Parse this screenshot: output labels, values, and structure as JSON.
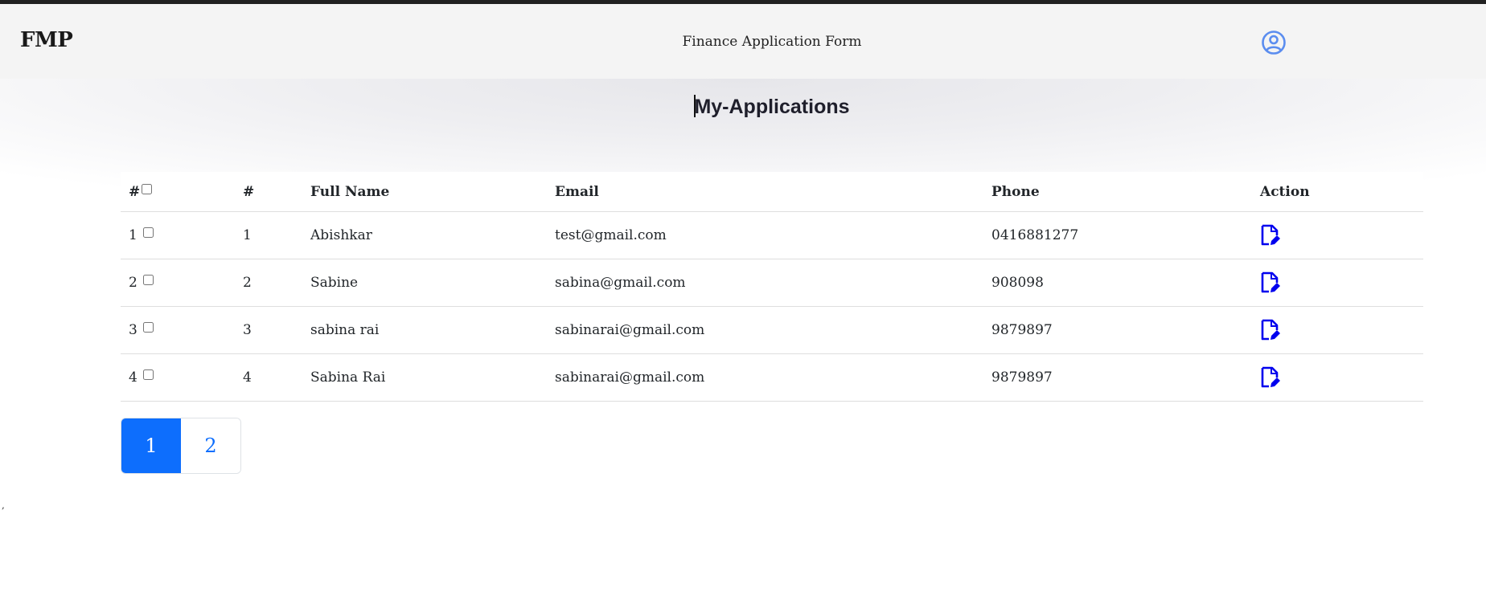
{
  "navbar": {
    "brand": "FMP",
    "title": "Finance Application Form",
    "user_icon": "user-circle-icon",
    "accent_color": "#5b8def"
  },
  "page": {
    "title": "My-Applications"
  },
  "table": {
    "headers": [
      "#",
      "#",
      "Full Name",
      "Email",
      "Phone",
      "Action"
    ],
    "rows": [
      {
        "index": "1",
        "id": "1",
        "name": "Abishkar",
        "email": "test@gmail.com",
        "phone": "0416881277"
      },
      {
        "index": "2",
        "id": "2",
        "name": "Sabine",
        "email": "sabina@gmail.com",
        "phone": "908098"
      },
      {
        "index": "3",
        "id": "3",
        "name": "sabina rai",
        "email": "sabinarai@gmail.com",
        "phone": "9879897"
      },
      {
        "index": "4",
        "id": "4",
        "name": "Sabina Rai",
        "email": "sabinarai@gmail.com",
        "phone": "9879897"
      }
    ],
    "action_icon": "edit-document-icon",
    "action_color": "#0000ee"
  },
  "pagination": {
    "pages": [
      "1",
      "2"
    ],
    "active": "1",
    "active_color": "#0d6efd"
  },
  "stray_text": ","
}
